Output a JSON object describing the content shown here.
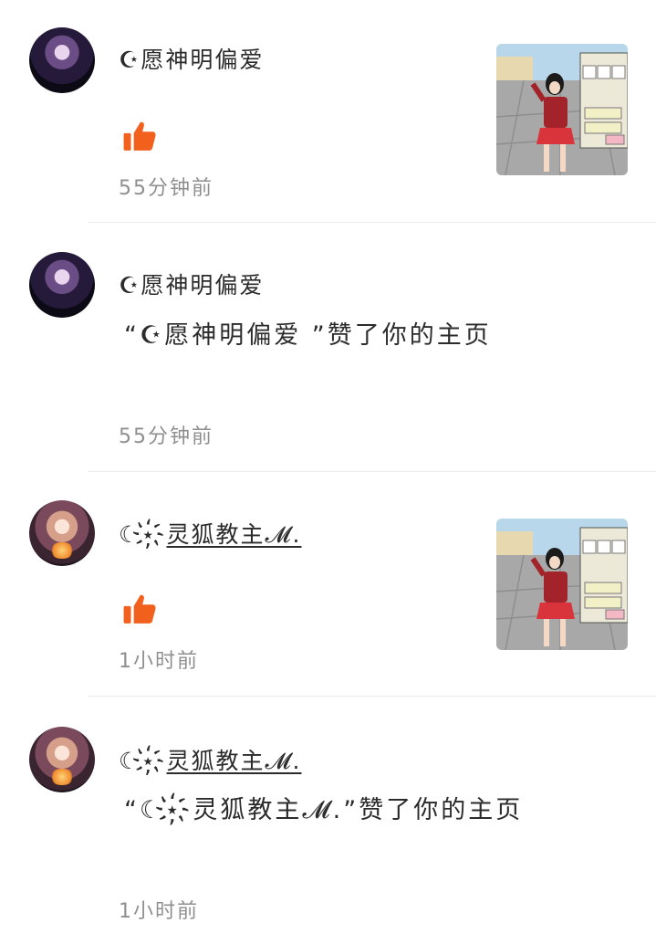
{
  "notifications": [
    {
      "type": "like",
      "user": "☪愿神明偏爱",
      "time": "55分钟前"
    },
    {
      "type": "profile",
      "user": "☪愿神明偏爱",
      "message": "“☪愿神明偏爱 ”赞了你的主页",
      "time": "55分钟前"
    },
    {
      "type": "like",
      "user_prefix": "☾⋆҉",
      "user_name": "灵狐教主𝓜.",
      "time": "1小时前"
    },
    {
      "type": "profile",
      "user_prefix": "☾⋆҉",
      "user_name": "灵狐教主𝓜.",
      "message": "“☾⋆҉灵狐教主𝓜.”赞了你的主页",
      "time": "1小时前"
    }
  ],
  "colors": {
    "like_orange": "#f2601e",
    "time_gray": "#8f8f8f",
    "divider": "#ececec"
  },
  "icons": [
    "thumbs-up-icon"
  ]
}
